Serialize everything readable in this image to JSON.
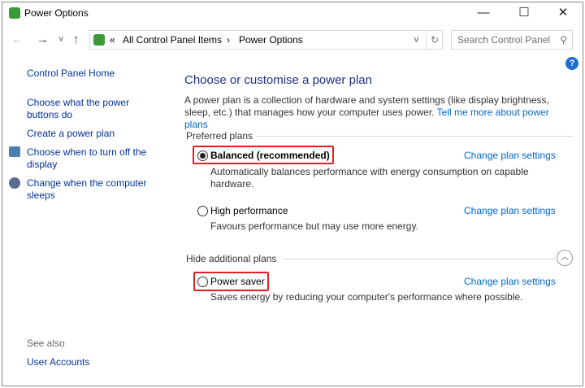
{
  "window": {
    "title": "Power Options",
    "minimize": "—",
    "maximize": "☐",
    "close": "✕"
  },
  "nav": {
    "back": "←",
    "forward": "→",
    "recent": "˅",
    "up": "↑"
  },
  "address": {
    "sep": "«",
    "crumbs": [
      "All Control Panel Items",
      "Power Options"
    ],
    "arrow": "›",
    "dropdown": "˅",
    "refresh": "↻"
  },
  "search": {
    "placeholder": "Search Control Panel",
    "icon": "⚲"
  },
  "help": "?",
  "sidebar": {
    "home": "Control Panel Home",
    "items": [
      "Choose what the power buttons do",
      "Create a power plan",
      "Choose when to turn off the display",
      "Change when the computer sleeps"
    ],
    "see_also": "See also",
    "user_accounts": "User Accounts"
  },
  "main": {
    "title": "Choose or customise a power plan",
    "intro": "A power plan is a collection of hardware and system settings (like display brightness, sleep, etc.) that manages how your computer uses power.",
    "intro_link": "Tell me more about power plans",
    "preferred": "Preferred plans",
    "hidden": "Hide additional plans",
    "change": "Change plan settings",
    "plans": [
      {
        "name": "Balanced (recommended)",
        "desc": "Automatically balances performance with energy consumption on capable hardware.",
        "selected": true
      },
      {
        "name": "High performance",
        "desc": "Favours performance but may use more energy.",
        "selected": false
      },
      {
        "name": "Power saver",
        "desc": "Saves energy by reducing your computer's performance where possible.",
        "selected": false
      }
    ]
  }
}
